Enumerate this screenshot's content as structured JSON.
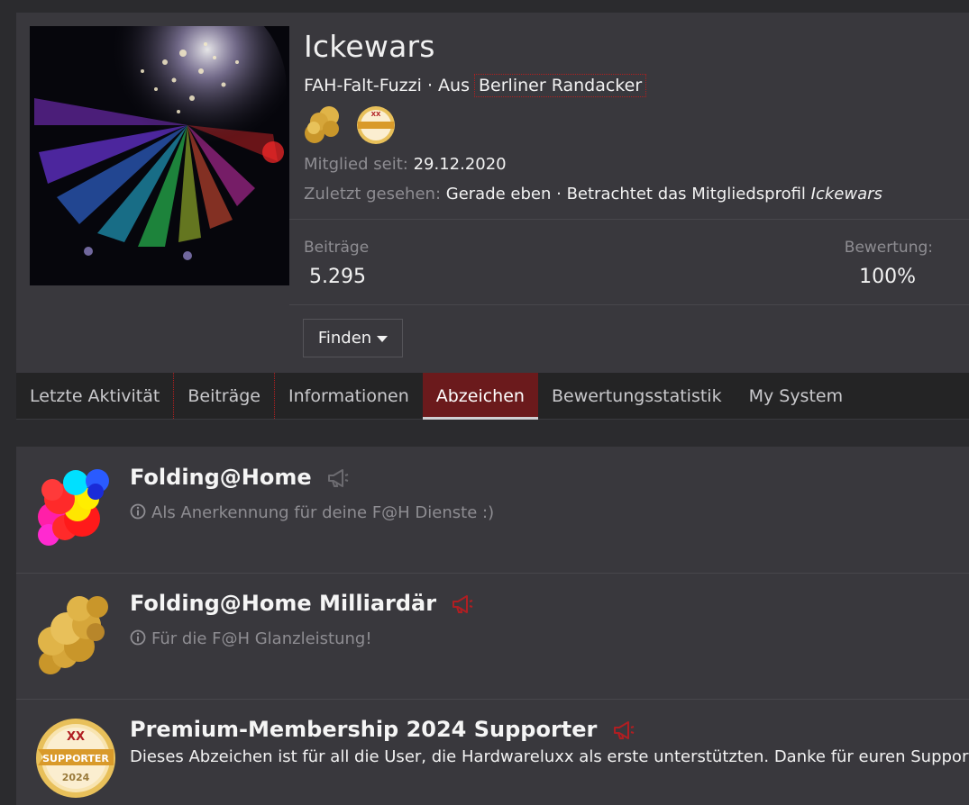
{
  "profile": {
    "username": "Ickewars",
    "rank": "FAH-Falt-Fuzzi",
    "from_label": " · Aus ",
    "location": "Berliner Randacker",
    "member_since_label": "Mitglied seit:",
    "member_since": "29.12.2020",
    "last_seen_label": "Zuletzt gesehen:",
    "last_seen": "Gerade eben · Betrachtet das Mitgliedsprofil",
    "last_seen_user": "Ickewars",
    "posts_label": "Beiträge",
    "posts": "5.295",
    "rating_label": "Bewertung:",
    "rating": "100%",
    "find_button": "Finden"
  },
  "tabs": [
    {
      "label": "Letzte Aktivität"
    },
    {
      "label": "Beiträge"
    },
    {
      "label": "Informationen"
    },
    {
      "label": "Abzeichen",
      "active": true
    },
    {
      "label": "Bewertungsstatistik"
    },
    {
      "label": "My System"
    }
  ],
  "badges": [
    {
      "title": "Folding@Home",
      "desc": "Als Anerkennung für deine F@H Dienste :)",
      "icon": "colorful-molecule-icon",
      "megaphone_color": "#6c6b70"
    },
    {
      "title": "Folding@Home Milliardär",
      "desc": "Für die F@H Glanzleistung!",
      "icon": "gold-molecule-icon",
      "megaphone_color": "#b01e22"
    },
    {
      "title": "Premium-Membership 2024 Supporter",
      "desc": "Dieses Abzeichen ist für all die User, die Hardwareluxx als erste unterstützten. Danke für euren Support!",
      "icon": "supporter-seal-icon",
      "megaphone_color": "#b01e22"
    }
  ],
  "seal": {
    "top": "XX",
    "middle": "SUPPORTER",
    "year": "2024"
  },
  "colors": {
    "accent": "#6b1a1c",
    "gold": "#d9a93a",
    "muted": "#8e8d92"
  }
}
